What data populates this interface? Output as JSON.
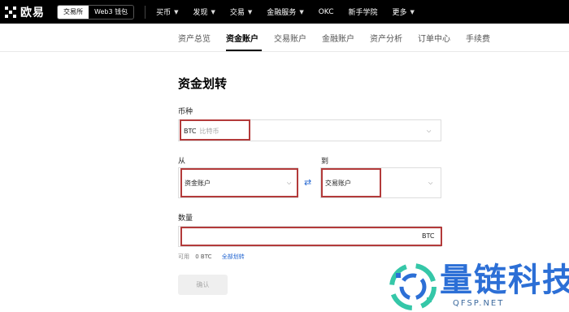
{
  "brand": {
    "name": "欧易"
  },
  "mode_switch": [
    "交易所",
    "Web3 钱包"
  ],
  "topnav": [
    {
      "label": "买币",
      "has_menu": true
    },
    {
      "label": "发现",
      "has_menu": true
    },
    {
      "label": "交易",
      "has_menu": true
    },
    {
      "label": "金融服务",
      "has_menu": true
    },
    {
      "label": "OKC",
      "has_menu": false
    },
    {
      "label": "新手学院",
      "has_menu": false
    },
    {
      "label": "更多",
      "has_menu": true
    }
  ],
  "subnav": [
    "资产总览",
    "资金账户",
    "交易账户",
    "金融账户",
    "资产分析",
    "订单中心",
    "手续费"
  ],
  "subnav_active": "资金账户",
  "page_title": "资金划转",
  "currency": {
    "label": "币种",
    "value": "BTC",
    "placeholder": "比特币"
  },
  "from": {
    "label": "从",
    "value": "资金账户"
  },
  "to": {
    "label": "到",
    "value": "交易账户"
  },
  "amount": {
    "label": "数量",
    "unit": "BTC"
  },
  "available": {
    "label": "可用",
    "value": "0 BTC",
    "transfer_all": "全部划转"
  },
  "confirm_label": "确认",
  "watermark": {
    "text": "量链科技",
    "url": "QFSP.NET"
  },
  "colors": {
    "nav_bg": "#000000",
    "highlight_border": "#b33a3a",
    "link": "#2366d1",
    "watermark": "#2c6fd6"
  }
}
